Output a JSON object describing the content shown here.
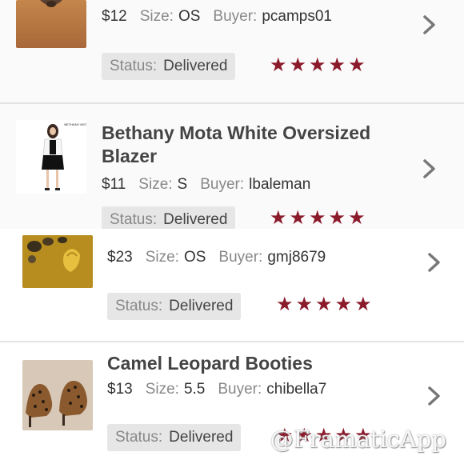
{
  "labels": {
    "size": "Size:",
    "buyer": "Buyer:",
    "status": "Status:"
  },
  "stars": "★★★★★",
  "colors": {
    "star": "#8b1a2b",
    "chevron": "#777777",
    "status_bg": "#e6e6e6"
  },
  "items": [
    {
      "title": "",
      "price": "$12",
      "size": "OS",
      "buyer": "pcamps01",
      "status": "Delivered",
      "rating": 5,
      "thumb_icon": "bow-accessory-photo"
    },
    {
      "title": "Bethany Mota White Oversized Blazer",
      "price": "$11",
      "size": "S",
      "buyer": "lbaleman",
      "status": "Delivered",
      "rating": 5,
      "thumb_icon": "blazer-outfit-photo",
      "thumb_brand": "BETHANY MOTA"
    },
    {
      "title": "",
      "price": "$23",
      "size": "OS",
      "buyer": "gmj8679",
      "status": "Delivered",
      "rating": 5,
      "thumb_icon": "jewelry-photo"
    },
    {
      "title": "Camel Leopard Booties",
      "price": "$13",
      "size": "5.5",
      "buyer": "chibella7",
      "status": "Delivered",
      "rating": 5,
      "thumb_icon": "leopard-booties-photo"
    }
  ],
  "watermark": "@FramaticApp"
}
